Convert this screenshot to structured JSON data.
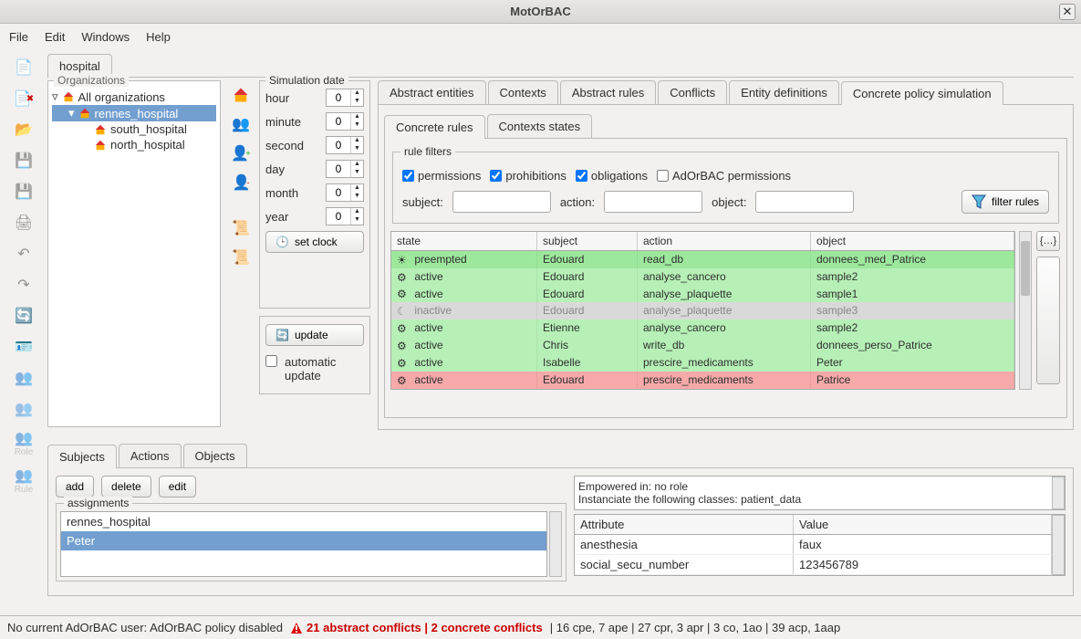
{
  "window": {
    "title": "MotOrBAC"
  },
  "menu": {
    "file": "File",
    "edit": "Edit",
    "windows": "Windows",
    "help": "Help"
  },
  "toolbar": {
    "icons": [
      "file-new",
      "file-error",
      "folder-open",
      "disk-save",
      "disk2",
      "print",
      "undo",
      "redo",
      "refresh",
      "contact-card",
      "users",
      "users-grey",
      "role",
      "rule"
    ],
    "role_label": "Role",
    "rule_label": "Rule"
  },
  "top_tab": "hospital",
  "organizations": {
    "legend": "Organizations",
    "root": "All organizations",
    "items": [
      {
        "name": "rennes_hospital",
        "selected": true,
        "children": [
          {
            "name": "south_hospital"
          },
          {
            "name": "north_hospital"
          }
        ]
      }
    ]
  },
  "sim_date": {
    "legend": "Simulation date",
    "fields": {
      "hour": {
        "label": "hour",
        "value": "0"
      },
      "minute": {
        "label": "minute",
        "value": "0"
      },
      "second": {
        "label": "second",
        "value": "0"
      },
      "day": {
        "label": "day",
        "value": "0"
      },
      "month": {
        "label": "month",
        "value": "0"
      },
      "year": {
        "label": "year",
        "value": "0"
      }
    },
    "set_clock": "set clock"
  },
  "update_panel": {
    "update": "update",
    "auto1": "automatic",
    "auto2": "update"
  },
  "main_tabs": [
    "Abstract entities",
    "Contexts",
    "Abstract rules",
    "Conflicts",
    "Entity definitions",
    "Concrete policy simulation"
  ],
  "main_active": 5,
  "sub_tabs": [
    "Concrete rules",
    "Contexts states"
  ],
  "sub_active": 0,
  "rule_filters": {
    "legend": "rule filters",
    "permissions": "permissions",
    "prohibitions": "prohibitions",
    "obligations": "obligations",
    "adorbac": "AdOrBAC permissions",
    "subject_label": "subject:",
    "action_label": "action:",
    "object_label": "object:",
    "filter_rules": "filter rules"
  },
  "rules_table": {
    "headers": {
      "state": "state",
      "subject": "subject",
      "action": "action",
      "object": "object"
    },
    "rows": [
      {
        "state": "preempted",
        "subject": "Edouard",
        "action": "read_db",
        "object": "donnees_med_Patrice",
        "cls": "green2",
        "icon": "sun"
      },
      {
        "state": "active",
        "subject": "Edouard",
        "action": "analyse_cancero",
        "object": "sample2",
        "cls": "green",
        "icon": "gear"
      },
      {
        "state": "active",
        "subject": "Edouard",
        "action": "analyse_plaquette",
        "object": "sample1",
        "cls": "green",
        "icon": "gear"
      },
      {
        "state": "inactive",
        "subject": "Edouard",
        "action": "analyse_plaquette",
        "object": "sample3",
        "cls": "grey",
        "icon": "moon"
      },
      {
        "state": "active",
        "subject": "Etienne",
        "action": "analyse_cancero",
        "object": "sample2",
        "cls": "green",
        "icon": "gear"
      },
      {
        "state": "active",
        "subject": "Chris",
        "action": "write_db",
        "object": "donnees_perso_Patrice",
        "cls": "green",
        "icon": "gear"
      },
      {
        "state": "active",
        "subject": "Isabelle",
        "action": "prescire_medicaments",
        "object": "Peter",
        "cls": "green",
        "icon": "gear"
      },
      {
        "state": "active",
        "subject": "Edouard",
        "action": "prescire_medicaments",
        "object": "Patrice",
        "cls": "pink",
        "icon": "gear"
      }
    ]
  },
  "bottom_tabs": [
    "Subjects",
    "Actions",
    "Objects"
  ],
  "bottom_active": 0,
  "bottom_buttons": {
    "add": "add",
    "delete": "delete",
    "edit": "edit"
  },
  "assignments": {
    "legend": "assignments",
    "items": [
      {
        "label": "rennes_hospital",
        "selected": false
      },
      {
        "label": "Peter",
        "selected": true
      }
    ]
  },
  "empowered": {
    "line1": "Empowered in:  no role",
    "line2": "Instanciate the following classes: patient_data"
  },
  "attributes": {
    "headers": {
      "attr": "Attribute",
      "value": "Value"
    },
    "rows": [
      {
        "attr": "anesthesia",
        "value": "faux"
      },
      {
        "attr": "social_secu_number",
        "value": "123456789"
      }
    ]
  },
  "statusbar": {
    "left": "No current AdOrBAC user: AdOrBAC policy disabled",
    "conflicts": "21 abstract conflicts | 2 concrete conflicts",
    "rest": "| 16 cpe, 7 ape | 27 cpr, 3 apr | 3 co, 1ao | 39 acp, 1aap"
  }
}
